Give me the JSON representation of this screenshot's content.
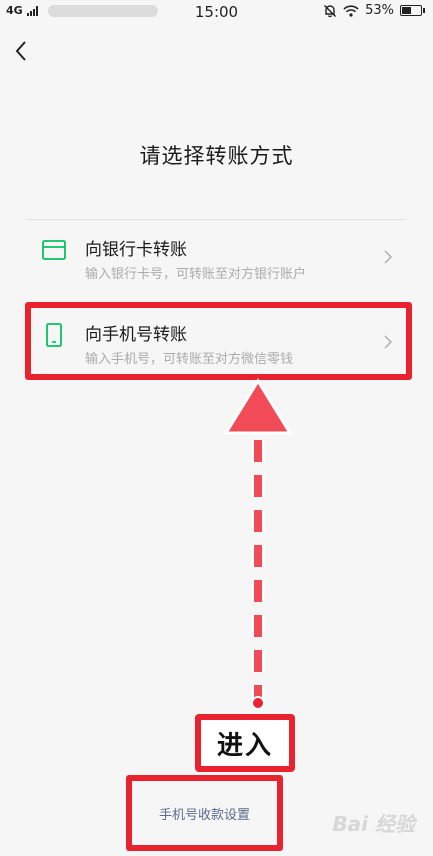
{
  "status_bar": {
    "network": "4G",
    "time": "15:00",
    "battery": "53%",
    "battery_level": 0.53
  },
  "header": {
    "title": "请选择转账方式"
  },
  "options": [
    {
      "title": "向银行卡转账",
      "description": "输入银行卡号，可转账至对方银行账户",
      "icon": "bank-card-icon"
    },
    {
      "title": "向手机号转账",
      "description": "输入手机号，可转账至对方微信零钱",
      "icon": "phone-icon"
    }
  ],
  "annotation": {
    "enter_label": "进入"
  },
  "footer": {
    "settings_link": "手机号收款设置",
    "watermark": "Bai 经验"
  },
  "colors": {
    "accent_green": "#07c160",
    "annotation_red": "#e8232f",
    "link_blue": "#5b6b8c"
  }
}
